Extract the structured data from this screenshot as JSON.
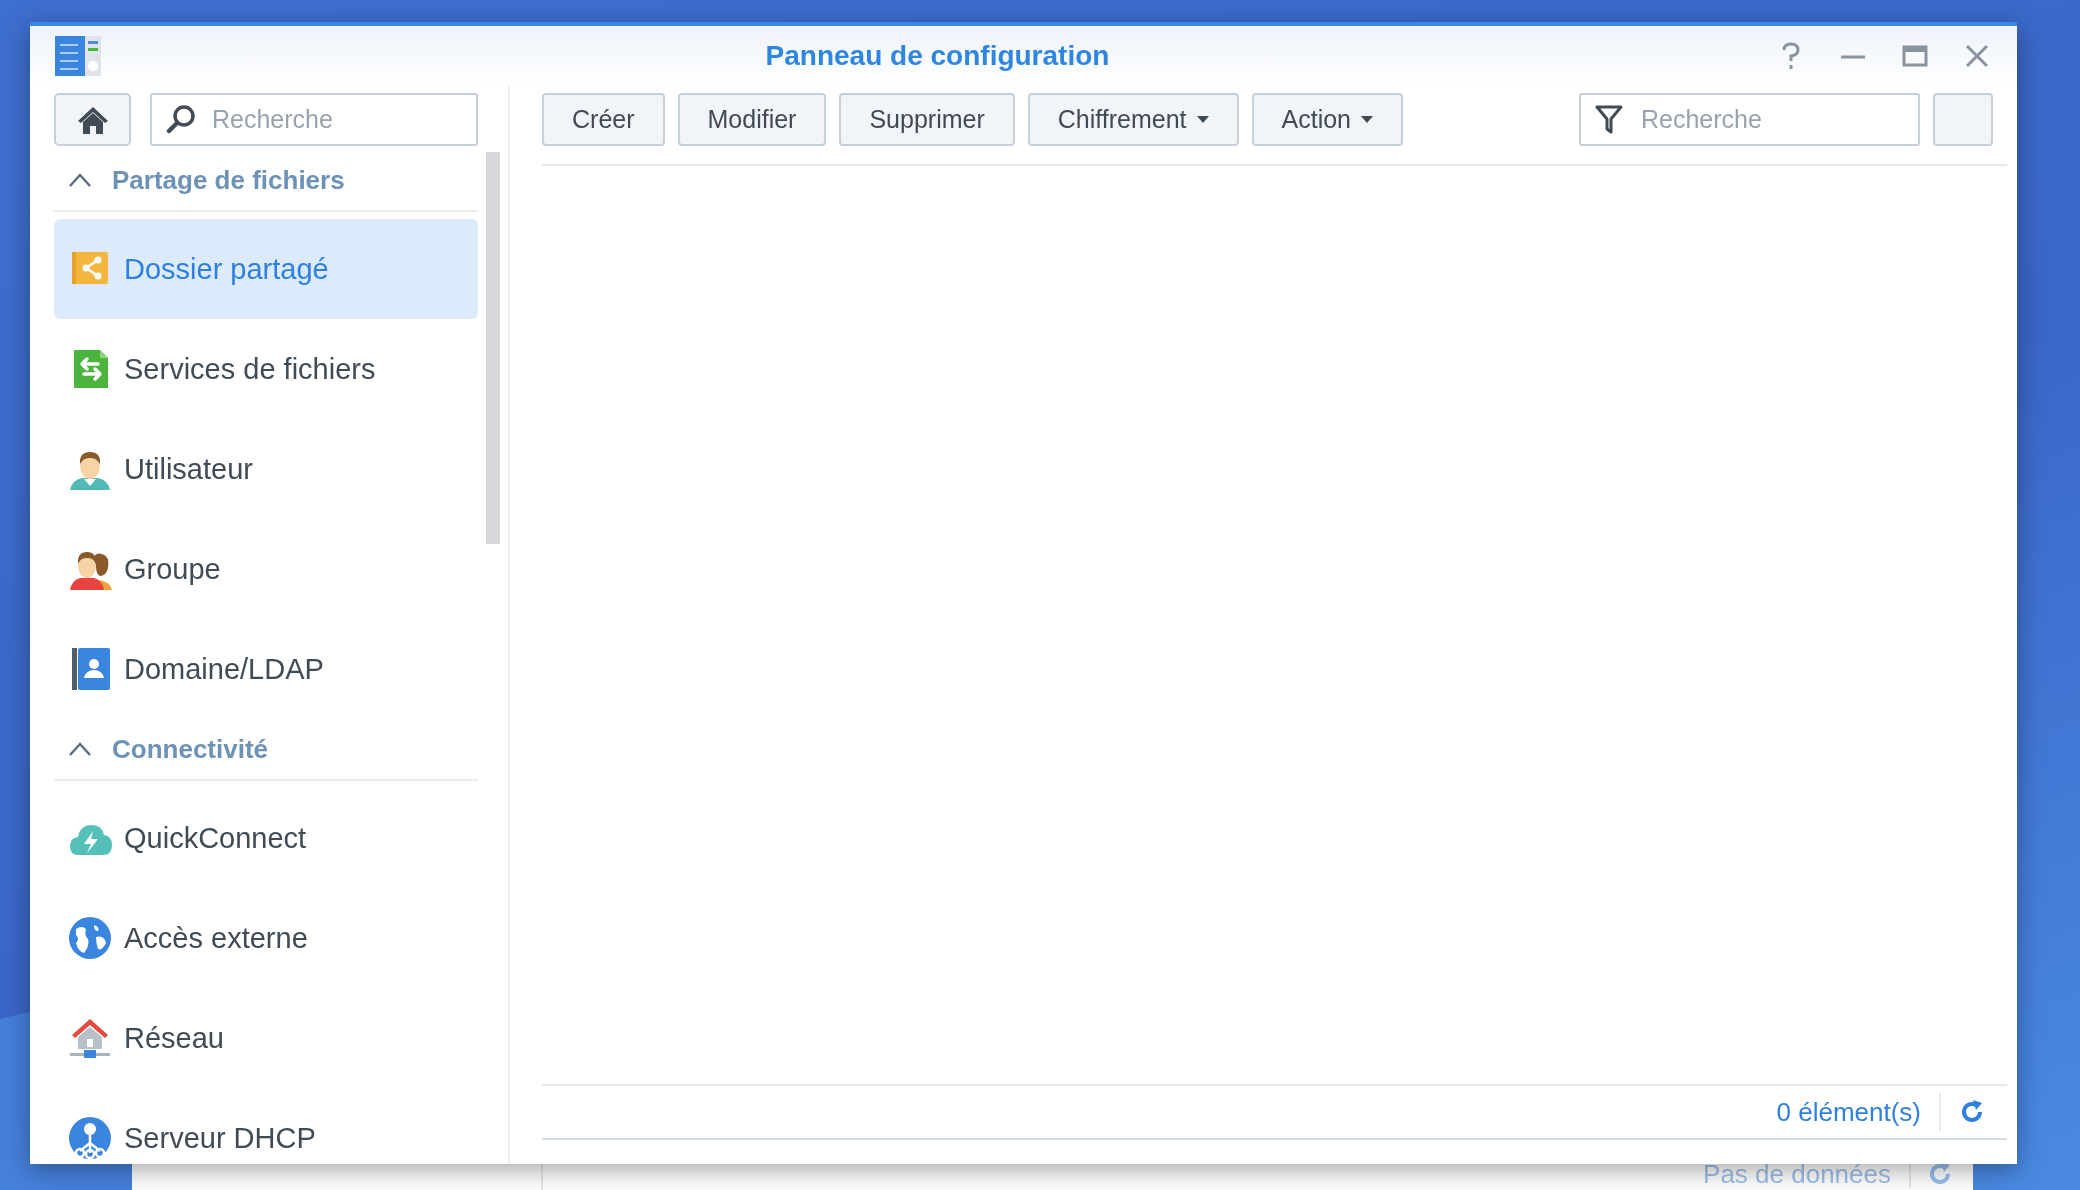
{
  "window": {
    "title": "Panneau de configuration"
  },
  "sidebar": {
    "search": {
      "placeholder": "Recherche"
    },
    "sections": [
      {
        "title": "Partage de fichiers",
        "expanded": true,
        "items": [
          {
            "label": "Dossier partagé",
            "selected": true
          },
          {
            "label": "Services de fichiers",
            "selected": false
          },
          {
            "label": "Utilisateur",
            "selected": false
          },
          {
            "label": "Groupe",
            "selected": false
          },
          {
            "label": "Domaine/LDAP",
            "selected": false
          }
        ]
      },
      {
        "title": "Connectivité",
        "expanded": true,
        "items": [
          {
            "label": "QuickConnect",
            "selected": false
          },
          {
            "label": "Accès externe",
            "selected": false
          },
          {
            "label": "Réseau",
            "selected": false
          },
          {
            "label": "Serveur DHCP",
            "selected": false
          }
        ]
      }
    ]
  },
  "toolbar": {
    "buttons": [
      {
        "label": "Créer",
        "dropdown": false
      },
      {
        "label": "Modifier",
        "dropdown": false
      },
      {
        "label": "Supprimer",
        "dropdown": false
      },
      {
        "label": "Chiffrement",
        "dropdown": true
      },
      {
        "label": "Action",
        "dropdown": true
      }
    ],
    "search": {
      "placeholder": "Recherche"
    }
  },
  "footer": {
    "count": "0 élément(s)"
  },
  "background_window": {
    "status": "Pas de données"
  }
}
